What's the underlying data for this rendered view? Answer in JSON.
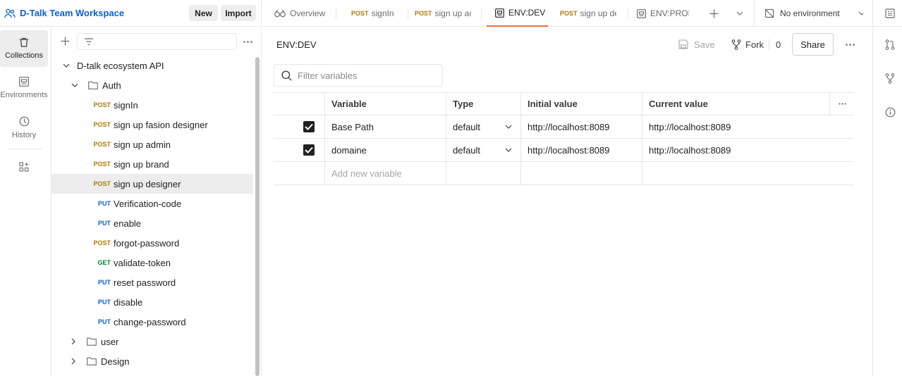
{
  "workspace": {
    "title": "D-Talk Team Workspace",
    "new_label": "New",
    "import_label": "Import"
  },
  "tabs": [
    {
      "label": "Overview",
      "method": ""
    },
    {
      "label": "signIn",
      "method": "POST"
    },
    {
      "label": "sign up ac",
      "method": "POST"
    },
    {
      "label": "ENV:DEV",
      "method": ""
    },
    {
      "label": "sign up de",
      "method": "POST"
    },
    {
      "label": "ENV:PROD",
      "method": ""
    }
  ],
  "environment_selector": {
    "label": "No environment"
  },
  "rail": [
    {
      "label": "Collections",
      "icon": "trash-can-icon"
    },
    {
      "label": "Environments",
      "icon": "environment-icon"
    },
    {
      "label": "History",
      "icon": "history-clock-icon"
    }
  ],
  "tree": {
    "collection": "D-talk ecosystem API",
    "folder_auth": "Auth",
    "requests": [
      {
        "method": "POST",
        "name": "signIn"
      },
      {
        "method": "POST",
        "name": "sign up fasion designer"
      },
      {
        "method": "POST",
        "name": "sign up admin"
      },
      {
        "method": "POST",
        "name": "sign up brand"
      },
      {
        "method": "POST",
        "name": "sign up designer"
      },
      {
        "method": "PUT",
        "name": "Verification-code"
      },
      {
        "method": "PUT",
        "name": "enable"
      },
      {
        "method": "POST",
        "name": "forgot-password"
      },
      {
        "method": "GET",
        "name": "validate-token"
      },
      {
        "method": "PUT",
        "name": "reset password"
      },
      {
        "method": "PUT",
        "name": "disable"
      },
      {
        "method": "PUT",
        "name": "change-password"
      }
    ],
    "folder_user": "user",
    "folder_design": "Design"
  },
  "main": {
    "title": "ENV:DEV",
    "save_label": "Save",
    "fork_label": "Fork",
    "fork_count": "0",
    "share_label": "Share",
    "filter_placeholder": "Filter variables"
  },
  "variables": {
    "headers": {
      "variable": "Variable",
      "type": "Type",
      "initial": "Initial value",
      "current": "Current value"
    },
    "rows": [
      {
        "name": "Base Path",
        "type": "default",
        "initial": "http://localhost:8089",
        "current": "http://localhost:8089",
        "checked": true
      },
      {
        "name": "domaine",
        "type": "default",
        "initial": "http://localhost:8089",
        "current": "http://localhost:8089",
        "checked": true
      }
    ],
    "add_placeholder": "Add new variable"
  },
  "colors": {
    "accent": "#f26b3a",
    "brand": "#0b5fd7",
    "post": "#ad7a03",
    "put": "#0b5fd7",
    "get": "#007f31"
  }
}
